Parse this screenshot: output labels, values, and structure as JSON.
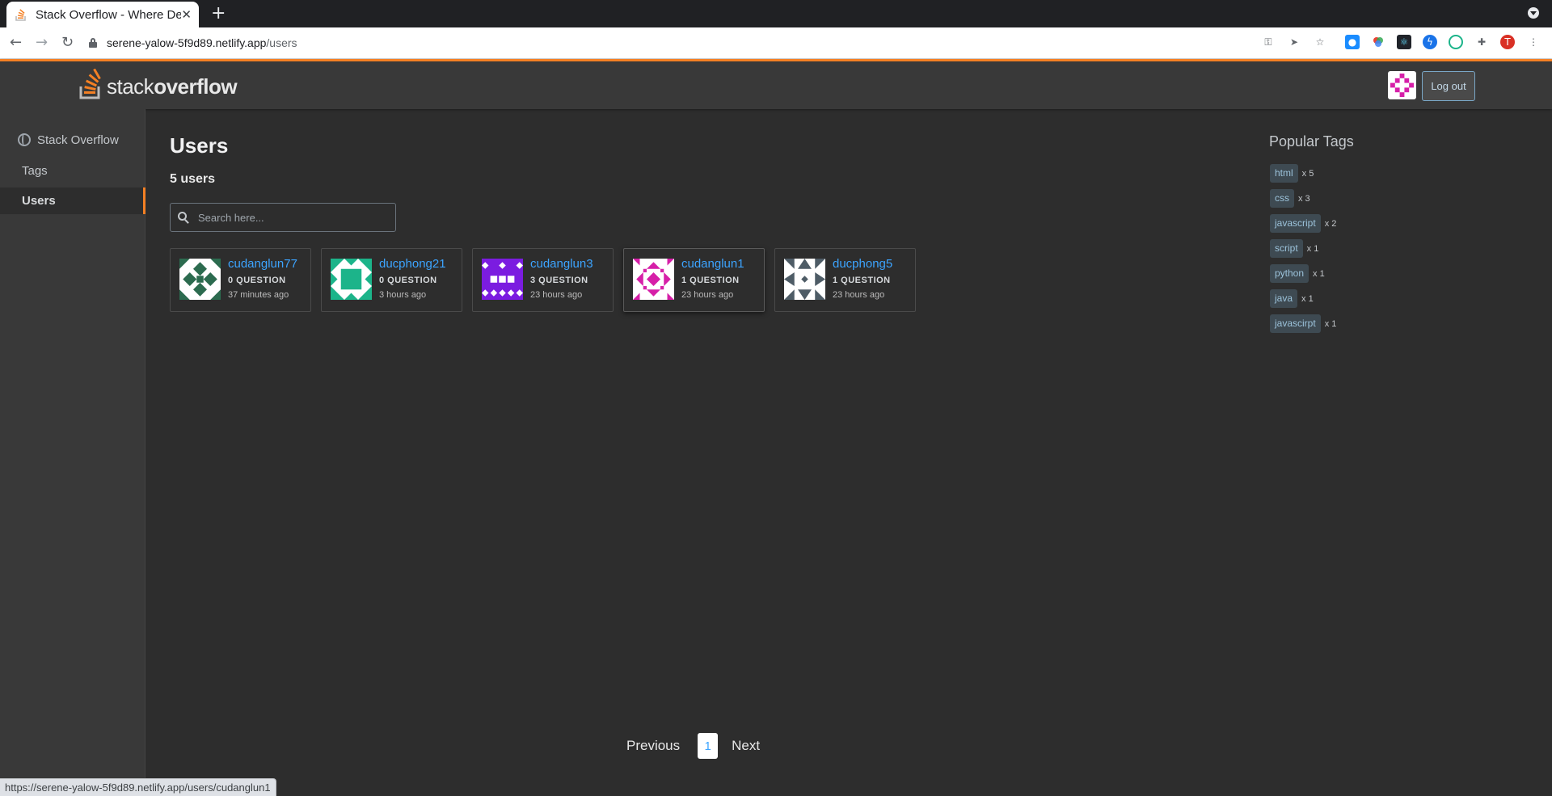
{
  "browser": {
    "tab_title": "Stack Overflow - Where Developers Learn, Share, & Build Careers",
    "new_tab": "+",
    "close_tab": "✕",
    "url_domain": "serene-yalow-5f9d89.netlify.app",
    "url_path": "/users",
    "status_url": "https://serene-yalow-5f9d89.netlify.app/users/cudanglun1",
    "profile_initial": "T"
  },
  "header": {
    "logo_light": "stack",
    "logo_bold": "overflow",
    "logout_label": "Log out"
  },
  "sidebar": {
    "items": [
      {
        "label": "Stack Overflow"
      },
      {
        "label": "Tags"
      },
      {
        "label": "Users"
      }
    ]
  },
  "main": {
    "title": "Users",
    "count": "5 users",
    "search_placeholder": "Search here...",
    "users": [
      {
        "name": "cudanglun77",
        "questions": "0 QUESTION",
        "time": "37 minutes ago",
        "color": "#2c6b4f"
      },
      {
        "name": "ducphong21",
        "questions": "0 QUESTION",
        "time": "3 hours ago",
        "color": "#1cb48a"
      },
      {
        "name": "cudanglun3",
        "questions": "3 QUESTION",
        "time": "23 hours ago",
        "color": "#7b1ce0"
      },
      {
        "name": "cudanglun1",
        "questions": "1 QUESTION",
        "time": "23 hours ago",
        "color": "#d61fa8"
      },
      {
        "name": "ducphong5",
        "questions": "1 QUESTION",
        "time": "23 hours ago",
        "color": "#4e5c66"
      }
    ]
  },
  "popular_tags": {
    "title": "Popular Tags",
    "tags": [
      {
        "name": "html",
        "count": "x 5"
      },
      {
        "name": "css",
        "count": "x 3"
      },
      {
        "name": "javascript",
        "count": "x 2"
      },
      {
        "name": "script",
        "count": "x 1"
      },
      {
        "name": "python",
        "count": "x 1"
      },
      {
        "name": "java",
        "count": "x 1"
      },
      {
        "name": "javascirpt",
        "count": "x 1"
      }
    ]
  },
  "pagination": {
    "previous": "Previous",
    "current": "1",
    "next": "Next"
  },
  "colors": {
    "accent": "#f48024",
    "link": "#3ca4ff",
    "header_avatar": "#d61fa8"
  }
}
